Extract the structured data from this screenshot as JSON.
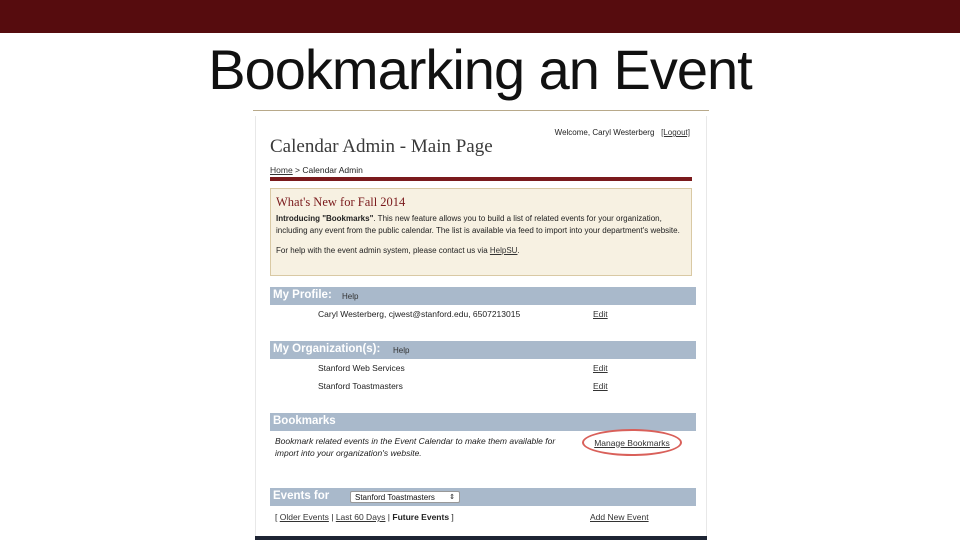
{
  "slide": {
    "title": "Bookmarking an Event"
  },
  "colors": {
    "top_bar": "#560c0e",
    "maroon_rule": "#7a1a1c",
    "section_bar": "#a9b9cb",
    "highlight_circle": "#d9605a",
    "news_background": "#f7f1e2"
  },
  "header": {
    "welcome_text": "Welcome, Caryl Westerberg",
    "logout_label": "[Logout]",
    "page_title": "Calendar Admin - Main Page",
    "breadcrumb": {
      "home_label": "Home",
      "separator": " > ",
      "current": "Calendar Admin"
    }
  },
  "news": {
    "heading": "What's New for Fall 2014",
    "intro_bold": "Introducing \"Bookmarks\"",
    "intro_text": ". This new feature allows you to build a list of related events for your organization, including any event from the public calendar. The list is available via feed to import into your department's website.",
    "help_text": "For help with the event admin system, please contact us via ",
    "help_link": "HelpSU",
    "help_end": "."
  },
  "profile": {
    "title": "My Profile:",
    "help_label": "Help",
    "info": "Caryl Westerberg, cjwest@stanford.edu, 6507213015",
    "edit_label": "Edit"
  },
  "organizations": {
    "title": "My Organization(s):",
    "help_label": "Help",
    "items": [
      {
        "name": "Stanford Web Services",
        "edit_label": "Edit"
      },
      {
        "name": "Stanford Toastmasters",
        "edit_label": "Edit"
      }
    ]
  },
  "bookmarks": {
    "title": "Bookmarks",
    "description": "Bookmark related events in the Event Calendar to make them available for import into your organization's website.",
    "manage_label": "Manage Bookmarks"
  },
  "events": {
    "title": "Events for",
    "selected_org": "Stanford Toastmasters",
    "nav_open": "[ ",
    "older_label": "Older Events",
    "sep": " | ",
    "last60_label": "Last 60 Days",
    "future_label": "Future Events",
    "nav_close": " ]",
    "add_label": "Add New Event"
  }
}
